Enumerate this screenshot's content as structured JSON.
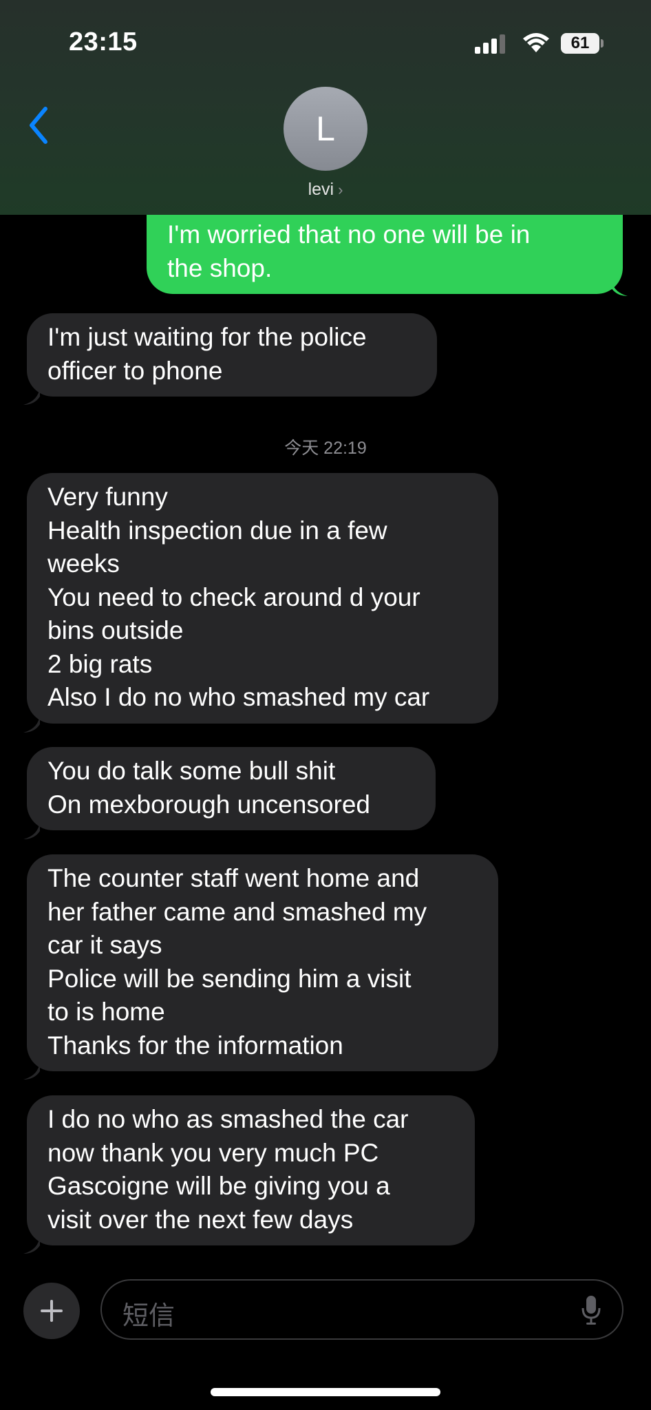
{
  "status_bar": {
    "time": "23:15",
    "battery": "61"
  },
  "header": {
    "avatar_initial": "L",
    "contact_name": "levi",
    "chevron": "›"
  },
  "messages": [
    {
      "from": "me",
      "text": "I'm worried that no one will be in\nthe shop."
    },
    {
      "from": "them",
      "text": "I'm just waiting for the police\nofficer to phone"
    },
    {
      "from": "them",
      "text": "Very funny\nHealth inspection due in a few\nweeks\nYou need to check around d your\nbins outside\n2 big rats\nAlso I do no who smashed my car"
    },
    {
      "from": "them",
      "text": "You do talk some bull shit\nOn mexborough uncensored"
    },
    {
      "from": "them",
      "text": "The counter staff went home and\nher father came and smashed my\ncar it says\nPolice will be sending him a visit\nto is home\nThanks for the information"
    },
    {
      "from": "them",
      "text": "I do no who as smashed the car\nnow thank you very much PC\nGascoigne will be giving you a\nvisit over the next few days"
    }
  ],
  "timestamp": "今天 22:19",
  "composer": {
    "placeholder": "短信"
  },
  "colors": {
    "outgoing": "#30d158",
    "incoming": "#262628",
    "accent": "#0a84ff"
  },
  "icons": [
    "back-chevron-icon",
    "signal-icon",
    "wifi-icon",
    "battery-icon",
    "plus-icon",
    "mic-icon"
  ]
}
